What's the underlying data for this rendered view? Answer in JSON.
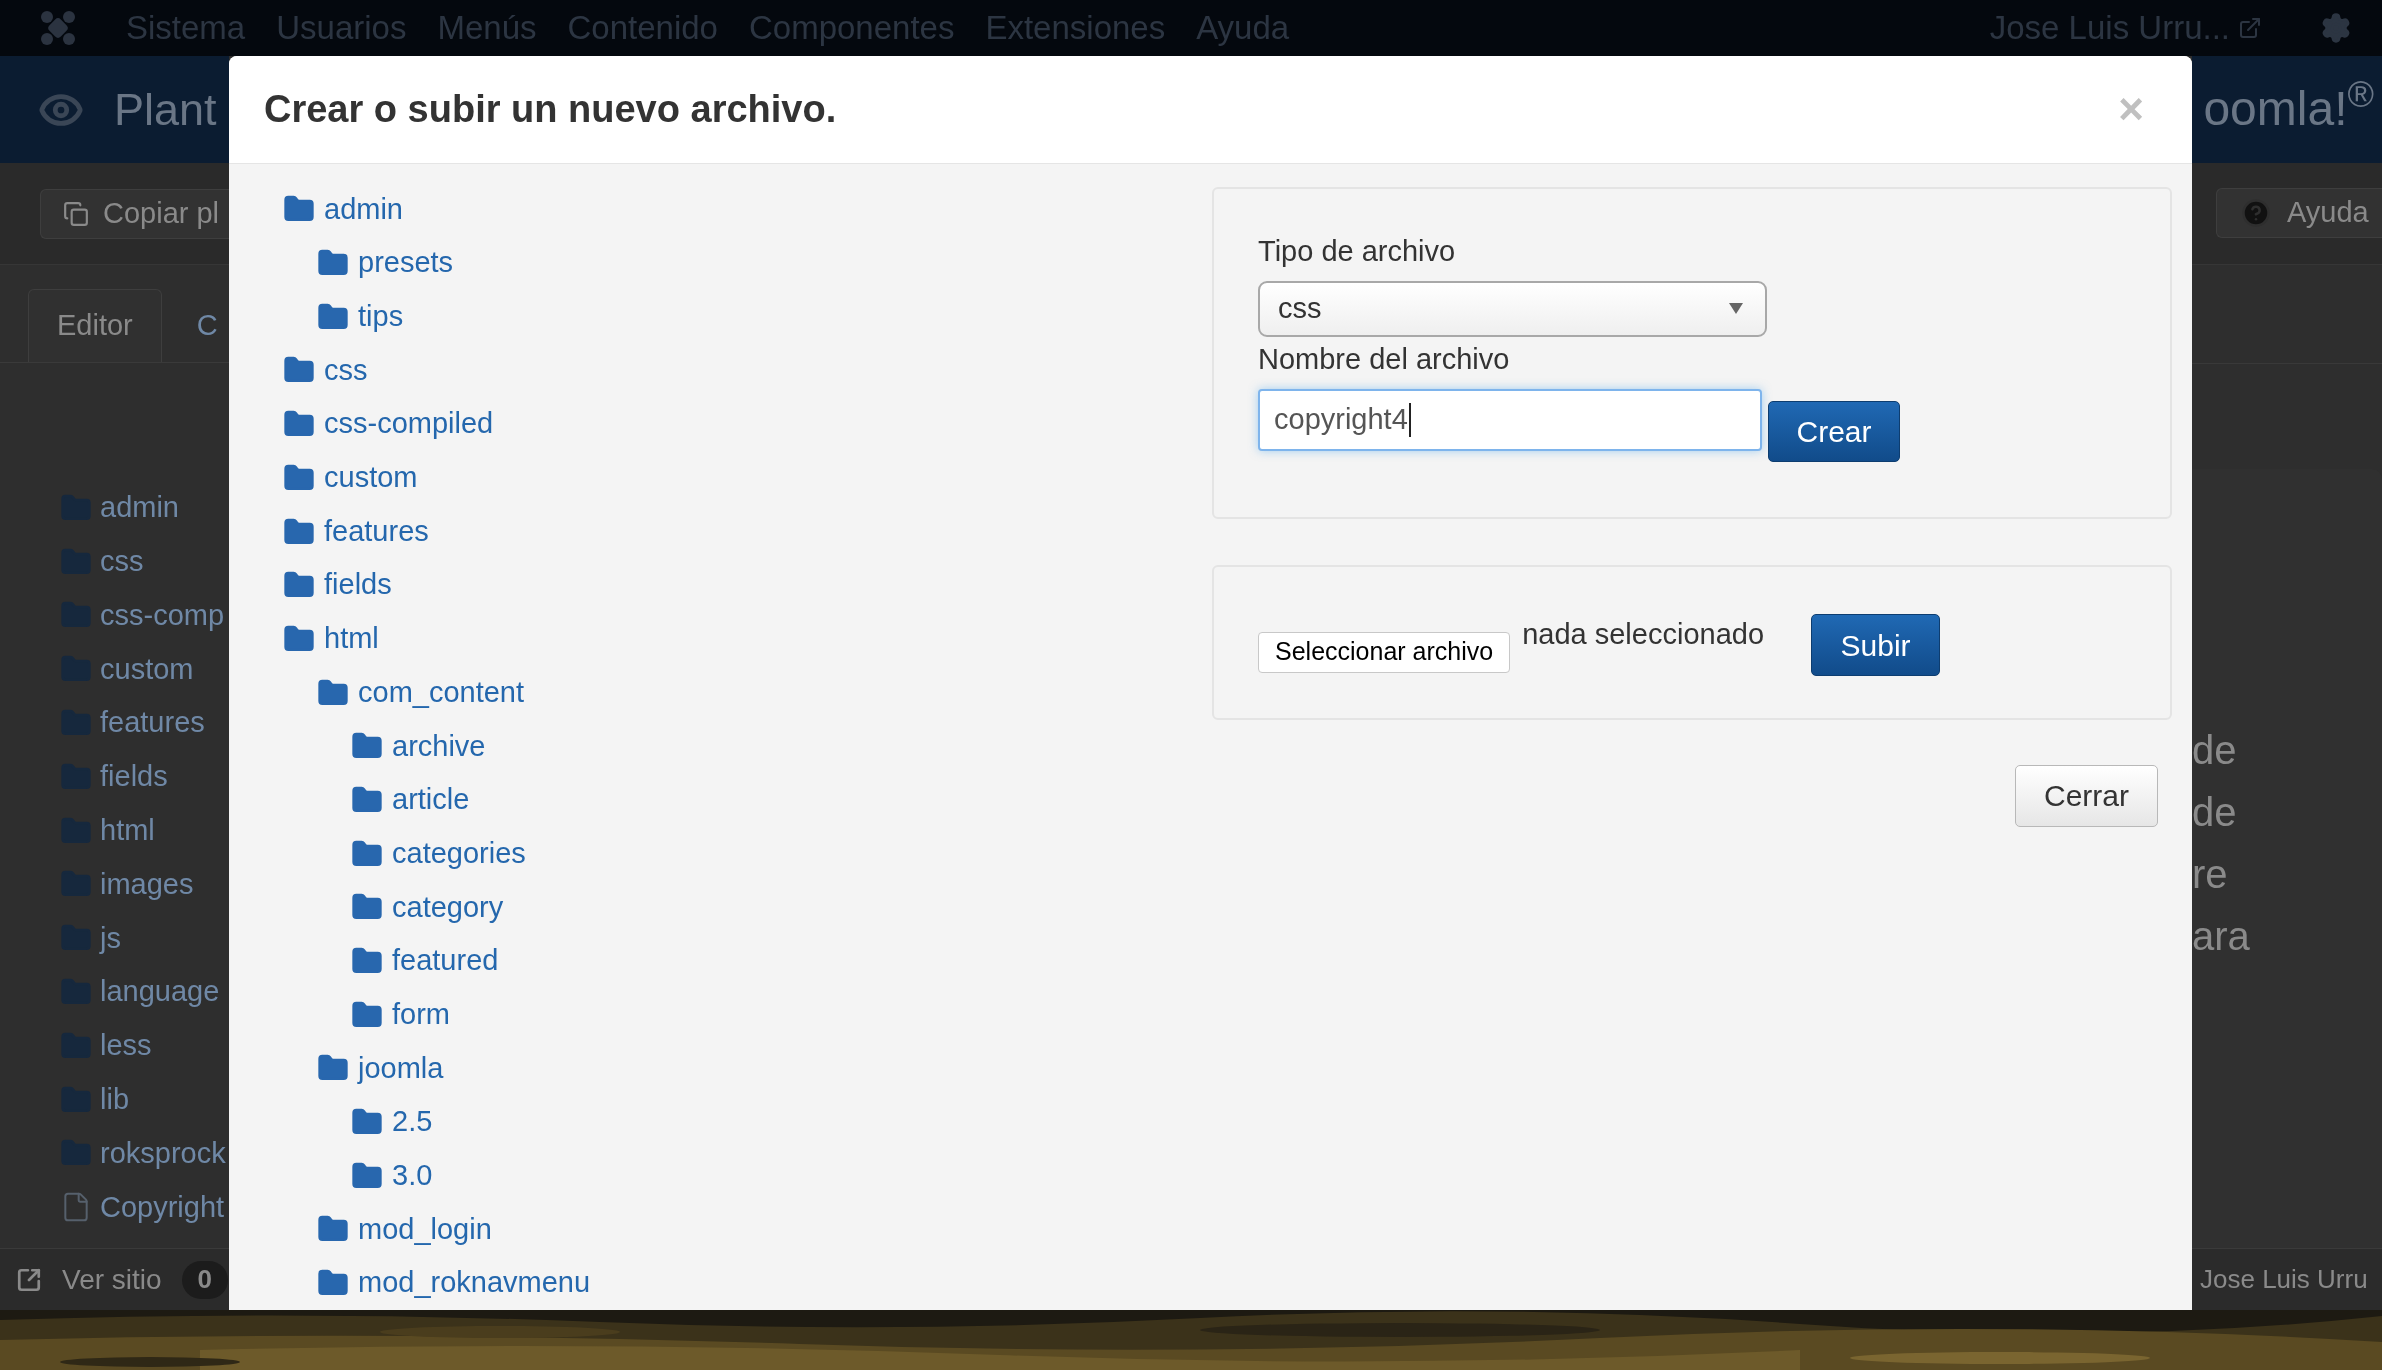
{
  "top_menu": {
    "items": [
      "Sistema",
      "Usuarios",
      "Menús",
      "Contenido",
      "Componentes",
      "Extensiones",
      "Ayuda"
    ],
    "user": "Jose Luis Urru..."
  },
  "background": {
    "header_title": "Plant",
    "logo": "oomla!$^{®}$",
    "toolbar_button": "Copiar pl",
    "help_button": "Ayuda",
    "tabs": [
      {
        "label": "Editor",
        "selected": true
      },
      {
        "label": "C",
        "selected": false
      }
    ],
    "file_tree": [
      {
        "name": "admin",
        "kind": "folder"
      },
      {
        "name": "css",
        "kind": "folder"
      },
      {
        "name": "css-comp",
        "kind": "folder"
      },
      {
        "name": "custom",
        "kind": "folder"
      },
      {
        "name": "features",
        "kind": "folder"
      },
      {
        "name": "fields",
        "kind": "folder"
      },
      {
        "name": "html",
        "kind": "folder"
      },
      {
        "name": "images",
        "kind": "folder"
      },
      {
        "name": "js",
        "kind": "folder"
      },
      {
        "name": "language",
        "kind": "folder"
      },
      {
        "name": "less",
        "kind": "folder"
      },
      {
        "name": "lib",
        "kind": "folder"
      },
      {
        "name": "roksprock",
        "kind": "folder"
      },
      {
        "name": "Copyright",
        "kind": "file"
      }
    ],
    "text_fragments": [
      "de",
      "de",
      "re",
      "ara"
    ],
    "footer": {
      "view_site": "Ver sitio",
      "badge": "0",
      "user": "Jose Luis Urru"
    }
  },
  "modal": {
    "title": "Crear o subir un nuevo archivo.",
    "close": "×",
    "tree": [
      {
        "name": "admin",
        "children": [
          {
            "name": "presets"
          },
          {
            "name": "tips"
          }
        ]
      },
      {
        "name": "css"
      },
      {
        "name": "css-compiled"
      },
      {
        "name": "custom"
      },
      {
        "name": "features"
      },
      {
        "name": "fields"
      },
      {
        "name": "html",
        "children": [
          {
            "name": "com_content",
            "children": [
              {
                "name": "archive"
              },
              {
                "name": "article"
              },
              {
                "name": "categories"
              },
              {
                "name": "category"
              },
              {
                "name": "featured"
              },
              {
                "name": "form"
              }
            ]
          },
          {
            "name": "joomla",
            "children": [
              {
                "name": "2.5"
              },
              {
                "name": "3.0"
              }
            ]
          },
          {
            "name": "mod_login"
          },
          {
            "name": "mod_roknavmenu"
          }
        ]
      }
    ],
    "create_form": {
      "type_label": "Tipo de archivo",
      "type_value": "css",
      "name_label": "Nombre del archivo",
      "name_value": "copyright4",
      "button": "Crear"
    },
    "upload_form": {
      "choose_button": "Seleccionar archivo",
      "file_status": "nada seleccionado",
      "button": "Subir"
    },
    "close_button": "Cerrar"
  }
}
